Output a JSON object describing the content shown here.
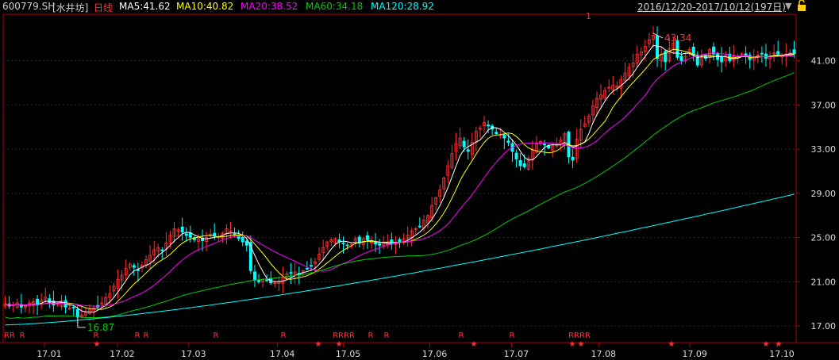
{
  "header": {
    "code": "600779.SH",
    "name": "[水井坊]",
    "period": "日线",
    "ma5": "MA5:41.62",
    "ma10": "MA10:40.82",
    "ma20": "MA20:38.52",
    "ma60": "MA60:34.18",
    "ma120": "MA120:28.92",
    "range": "2016/12/20-2017/10/12(197日)",
    "marker_top": "1"
  },
  "colors": {
    "up": "#ff3030",
    "down": "#00ffff",
    "ma5": "#ffffff",
    "ma10": "#ffff00",
    "ma20": "#ff00ff",
    "ma60": "#00cc00",
    "ma120": "#00ffff",
    "axis": "#b00000",
    "grid": "#2a2a2a",
    "label": "#dcdcdc"
  },
  "icons": [
    "dropdown-icon",
    "lock-icon"
  ],
  "chart_data": {
    "type": "candlestick",
    "x_axis": [
      "17.01",
      "17.02",
      "17.03",
      "17.04",
      "17.05",
      "17.06",
      "17.07",
      "17.08",
      "17.09",
      "17.10"
    ],
    "y_ticks": [
      "41.00",
      "37.00",
      "33.00",
      "29.00",
      "25.00",
      "21.00",
      "17.00"
    ],
    "ylim": [
      15.5,
      45.2
    ],
    "annotations": {
      "high": "43.34",
      "low": "16.87"
    },
    "ma_labels": [
      "MA5",
      "MA10",
      "MA20",
      "MA60",
      "MA120"
    ],
    "r_markers": [
      "RR",
      "R",
      "R",
      "R",
      "R",
      "R",
      "R",
      "RRRR",
      "R",
      "R",
      "R",
      "R",
      "RRRR"
    ],
    "star_markers": 10,
    "closes": [
      19.0,
      18.8,
      18.9,
      19.1,
      18.7,
      18.8,
      19.1,
      19.2,
      18.9,
      19.3,
      19.6,
      19.1,
      18.9,
      19.0,
      19.3,
      18.7,
      18.6,
      18.7,
      17.8,
      18.0,
      18.3,
      18.5,
      18.6,
      18.7,
      19.1,
      19.6,
      19.9,
      20.6,
      21.2,
      21.6,
      22.2,
      22.6,
      22.3,
      22.0,
      22.5,
      23.0,
      23.4,
      23.9,
      24.1,
      23.8,
      24.5,
      25.2,
      25.8,
      25.7,
      25.5,
      25.2,
      25.0,
      24.8,
      24.9,
      24.7,
      25.0,
      25.3,
      25.2,
      25.1,
      25.4,
      25.8,
      25.6,
      25.2,
      24.9,
      24.6,
      24.3,
      22.0,
      21.2,
      21.0,
      21.2,
      21.1,
      20.9,
      20.9,
      21.0,
      21.4,
      21.7,
      21.8,
      21.9,
      21.7,
      22.0,
      22.2,
      22.4,
      22.8,
      23.5,
      24.1,
      24.6,
      24.8,
      24.9,
      24.6,
      24.5,
      24.3,
      24.4,
      24.9,
      24.5,
      24.9,
      24.8,
      24.6,
      24.4,
      24.3,
      24.6,
      24.5,
      24.4,
      24.6,
      24.6,
      24.9,
      25.2,
      25.6,
      25.8,
      26.0,
      26.6,
      27.0,
      27.9,
      28.6,
      29.3,
      30.4,
      31.5,
      32.6,
      33.5,
      34.0,
      33.2,
      32.8,
      33.6,
      34.6,
      34.9,
      35.4,
      35.1,
      34.8,
      34.4,
      34.3,
      34.0,
      33.6,
      32.8,
      32.1,
      31.5,
      31.4,
      32.2,
      33.0,
      33.5,
      33.7,
      33.4,
      33.1,
      33.3,
      33.4,
      33.8,
      34.4,
      32.3,
      32.0,
      33.9,
      34.8,
      35.3,
      36.0,
      36.9,
      37.6,
      37.9,
      38.3,
      38.6,
      38.8,
      38.7,
      39.3,
      39.9,
      40.4,
      40.8,
      41.6,
      41.8,
      42.3,
      42.9,
      43.3,
      41.2,
      41.6,
      40.9,
      42.1,
      42.6,
      41.3,
      41.0,
      41.4,
      42.0,
      41.5,
      40.6,
      41.3,
      41.2,
      42.0,
      41.6,
      41.1,
      40.9,
      41.4,
      41.0,
      41.5,
      41.3,
      41.6,
      41.4,
      41.1,
      41.3,
      41.5,
      41.6,
      41.2,
      41.4,
      41.7,
      41.6,
      41.5,
      41.6,
      41.7,
      41.62
    ]
  }
}
